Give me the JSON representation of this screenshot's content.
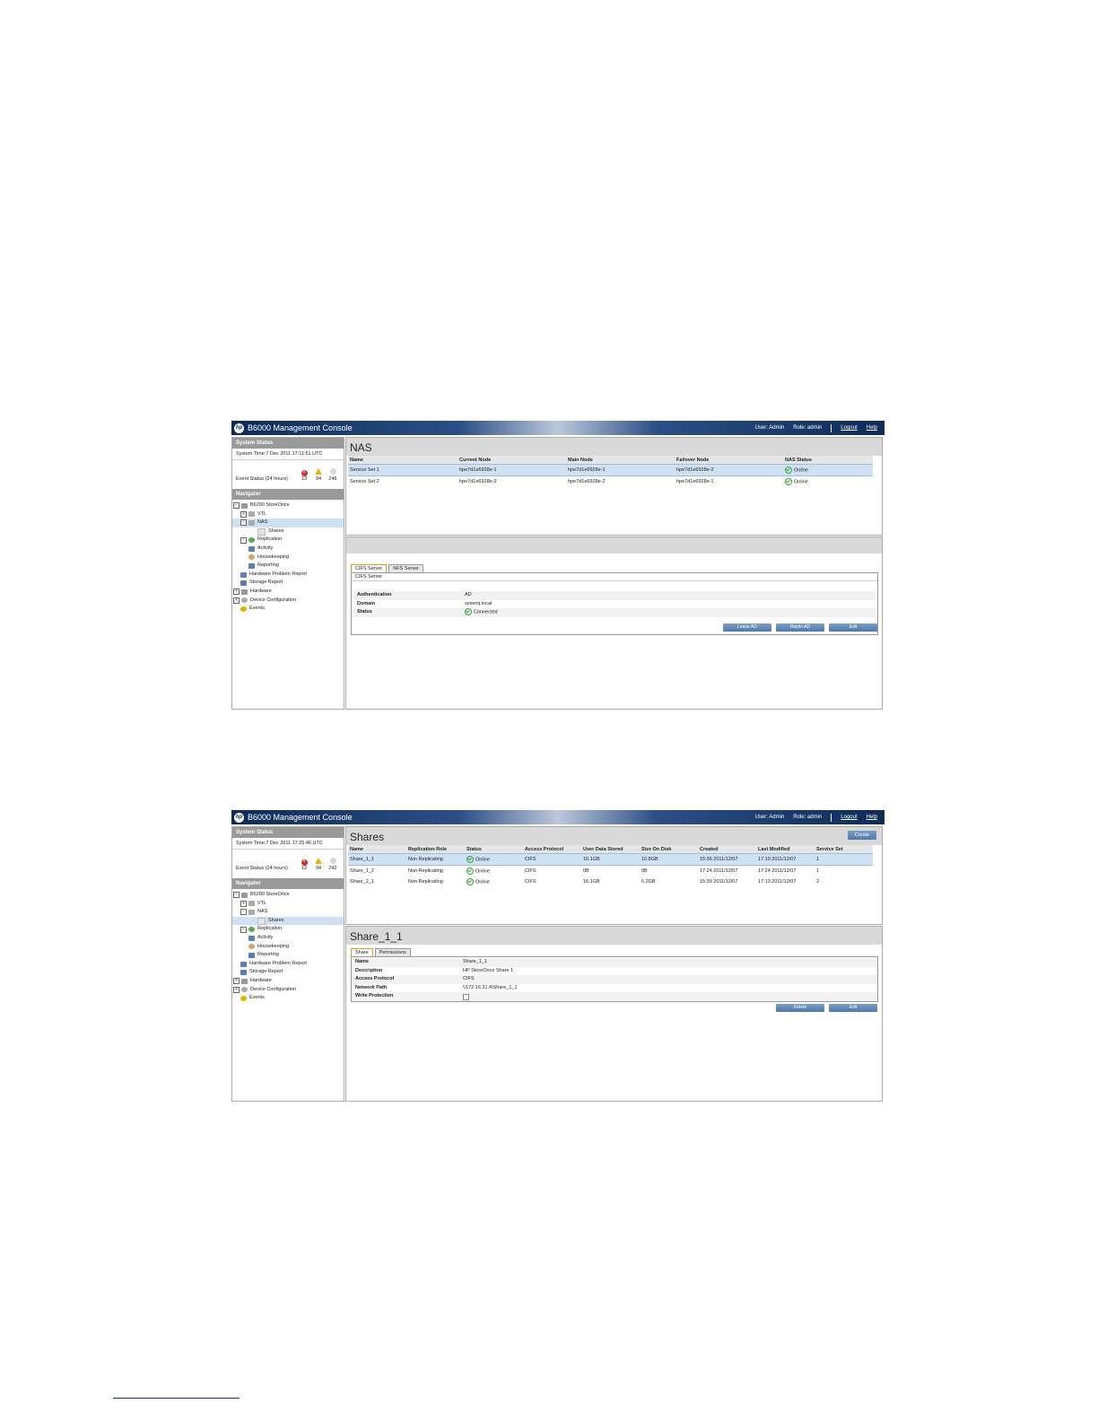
{
  "footnote_rule": "",
  "shot1": {
    "title": "B6000 Management Console",
    "user_label": "User:",
    "user": "Admin",
    "role_label": "Role:",
    "role": "admin",
    "logout": "Logout",
    "help": "Help",
    "system_status_header": "System Status",
    "system_time": "System Time:7 Dec 2011 17:11:51 UTC",
    "event_status_label": "Event Status (24 hours)",
    "event_counts": [
      "13",
      "94",
      "246"
    ],
    "navigator_header": "Navigator",
    "nav": [
      "B6200 StoreOnce",
      "VTL",
      "NAS",
      "Shares",
      "Replication",
      "Activity",
      "Housekeeping",
      "Reporting",
      "Hardware Problem Report",
      "Storage Report",
      "Hardware",
      "Device Configuration",
      "Events"
    ],
    "main_title": "NAS",
    "columns": [
      "Name",
      "Current Node",
      "Main Node",
      "Failover Node",
      "NAS Status"
    ],
    "rows": [
      [
        "Service Set 1",
        "hpe7d1e6928e-1",
        "hpe7d1e6928e-1",
        "hpe7d1e6928e-2",
        "Online"
      ],
      [
        "Service Set 2",
        "hpe7d1e6928e-2",
        "hpe7d1e6928e-2",
        "hpe7d1e6928e-1",
        "Online"
      ]
    ],
    "tabs": [
      "CIFS Server",
      "NFS Server"
    ],
    "section_label": "CIFS Server",
    "details": [
      {
        "k": "Authentication",
        "v": "AD"
      },
      {
        "k": "Domain",
        "v": "sysenq.local"
      },
      {
        "k": "Status",
        "v": "Connected"
      }
    ],
    "buttons": [
      "Leave AD",
      "Rejoin AD",
      "Edit"
    ]
  },
  "shot2": {
    "title": "B6000 Management Console",
    "user_label": "User:",
    "user": "Admin",
    "role_label": "Role:",
    "role": "admin",
    "logout": "Logout",
    "help": "Help",
    "system_status_header": "System Status",
    "system_time": "System Time:7 Dec 2011 17:25:46 UTC",
    "event_status_label": "Event Status (24 hours)",
    "event_counts": [
      "12",
      "94",
      "242"
    ],
    "navigator_header": "Navigator",
    "nav": [
      "B6200 StoreOnce",
      "VTL",
      "NAS",
      "Shares",
      "Replication",
      "Activity",
      "Housekeeping",
      "Reporting",
      "Hardware Problem Report",
      "Storage Report",
      "Hardware",
      "Device Configuration",
      "Events"
    ],
    "main_title": "Shares",
    "create_button": "Create",
    "columns": [
      "Name",
      "Replication Role",
      "Status",
      "Access Protocol",
      "User Data Stored",
      "Size On Disk",
      "Created",
      "Last Modified",
      "Service Set"
    ],
    "rows": [
      [
        "Share_1_1",
        "Non Replicating",
        "Online",
        "CIFS",
        "16.1GB",
        "10.8GB",
        "15:36 2011/12/07",
        "17:10 2011/12/07",
        "1"
      ],
      [
        "Share_1_2",
        "Non Replicating",
        "Online",
        "CIFS",
        "0B",
        "0B",
        "17:24 2011/12/07",
        "17:24 2011/12/07",
        "1"
      ],
      [
        "Share_2_1",
        "Non Replicating",
        "Online",
        "CIFS",
        "16.1GB",
        "6.2GB",
        "15:39 2011/12/07",
        "17:13 2011/12/07",
        "2"
      ]
    ],
    "detail_title": "Share_1_1",
    "tabs": [
      "Share",
      "Permissions"
    ],
    "details": [
      {
        "k": "Name",
        "v": "Share_1_1"
      },
      {
        "k": "Description",
        "v": "HP StoreOnce Share 1"
      },
      {
        "k": "Access Protocol",
        "v": "CIFS"
      },
      {
        "k": "Network Path",
        "v": "\\\\172.16.31.4\\Share_1_1"
      },
      {
        "k": "Write Protection",
        "v": ""
      }
    ],
    "buttons": [
      "Delete",
      "Edit"
    ]
  }
}
